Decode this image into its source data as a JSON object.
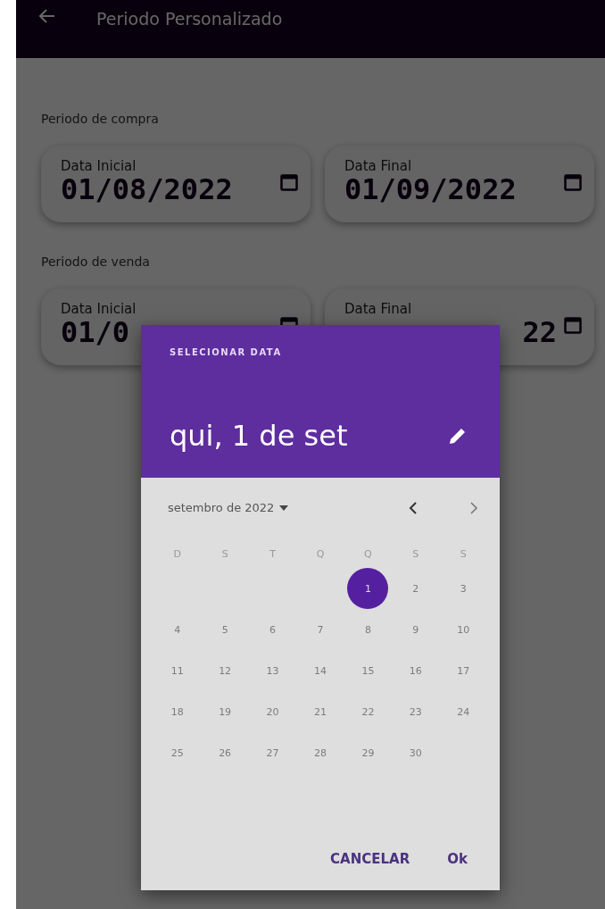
{
  "app_bar": {
    "title": "Periodo Personalizado"
  },
  "sections": [
    {
      "label": "Periodo de compra",
      "fields": [
        {
          "label": "Data Inicial",
          "value": "01/08/2022"
        },
        {
          "label": "Data Final",
          "value": "01/09/2022"
        }
      ]
    },
    {
      "label": "Periodo de venda",
      "fields": [
        {
          "label": "Data Inicial",
          "value": "01/0"
        },
        {
          "label": "Data Final",
          "value": "22"
        }
      ]
    }
  ],
  "dialog": {
    "overline": "SELECIONAR DATA",
    "selected_date": "qui, 1 de set",
    "month_label": "setembro de 2022",
    "weekdays": [
      "D",
      "S",
      "T",
      "Q",
      "Q",
      "S",
      "S"
    ],
    "days": [
      {
        "label": "1",
        "selected": true,
        "disabled": false
      },
      {
        "label": "2",
        "selected": false,
        "disabled": true
      },
      {
        "label": "3",
        "selected": false,
        "disabled": true
      },
      {
        "label": "4",
        "selected": false,
        "disabled": true
      },
      {
        "label": "5",
        "selected": false,
        "disabled": true
      },
      {
        "label": "6",
        "selected": false,
        "disabled": true
      },
      {
        "label": "7",
        "selected": false,
        "disabled": true
      },
      {
        "label": "8",
        "selected": false,
        "disabled": true
      },
      {
        "label": "9",
        "selected": false,
        "disabled": true
      },
      {
        "label": "10",
        "selected": false,
        "disabled": true
      },
      {
        "label": "11",
        "selected": false,
        "disabled": true
      },
      {
        "label": "12",
        "selected": false,
        "disabled": true
      },
      {
        "label": "13",
        "selected": false,
        "disabled": true
      },
      {
        "label": "14",
        "selected": false,
        "disabled": true
      },
      {
        "label": "15",
        "selected": false,
        "disabled": true
      },
      {
        "label": "16",
        "selected": false,
        "disabled": true
      },
      {
        "label": "17",
        "selected": false,
        "disabled": true
      },
      {
        "label": "18",
        "selected": false,
        "disabled": true
      },
      {
        "label": "19",
        "selected": false,
        "disabled": true
      },
      {
        "label": "20",
        "selected": false,
        "disabled": true
      },
      {
        "label": "21",
        "selected": false,
        "disabled": true
      },
      {
        "label": "22",
        "selected": false,
        "disabled": true
      },
      {
        "label": "23",
        "selected": false,
        "disabled": true
      },
      {
        "label": "24",
        "selected": false,
        "disabled": true
      },
      {
        "label": "25",
        "selected": false,
        "disabled": true
      },
      {
        "label": "26",
        "selected": false,
        "disabled": true
      },
      {
        "label": "27",
        "selected": false,
        "disabled": true
      },
      {
        "label": "28",
        "selected": false,
        "disabled": true
      },
      {
        "label": "29",
        "selected": false,
        "disabled": true
      },
      {
        "label": "30",
        "selected": false,
        "disabled": true
      }
    ],
    "buttons": [
      "CANCELAR",
      "Ok"
    ]
  }
}
